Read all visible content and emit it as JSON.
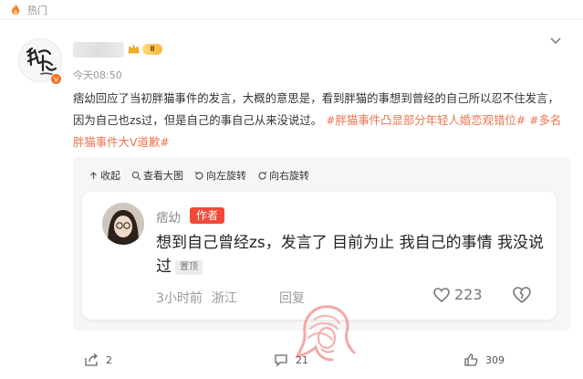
{
  "topbar": {
    "hot_label": "热门"
  },
  "post": {
    "username": "",
    "level": "Ⅱ",
    "time": "今天08:50",
    "text_main": "痞幼回应了当初胖猫事件的发言，大概的意思是，看到胖猫的事想到曾经的自己所以忍不住发言，因为自己也zs过，但是自己的事自己从来没说过。",
    "hashtag1": "#胖猫事件凸显部分年轻人婚恋观错位#",
    "hashtag2": "#多名胖猫事件大V道歉#"
  },
  "media_toolbar": {
    "collapse": "收起",
    "view_large": "查看大图",
    "rotate_left": "向左旋转",
    "rotate_right": "向右旋转"
  },
  "comment_card": {
    "name": "痞幼",
    "author_badge": "作者",
    "text": "想到自己曾经zs，发言了 目前为止 我自己的事情 我没说过",
    "pin_badge": "置顶",
    "time": "3小时前",
    "location": "浙江",
    "reply": "回复",
    "likes": "223"
  },
  "actions": {
    "forward_count": "2",
    "comment_count": "21",
    "like_count": "309"
  },
  "colors": {
    "hashtag": "#eb7350",
    "author_badge": "#f04a36",
    "hot_icon": "#ff7a2e"
  }
}
